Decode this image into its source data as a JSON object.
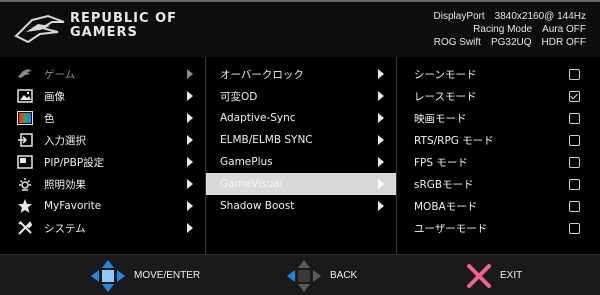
{
  "header": {
    "brand_line1": "REPUBLIC OF",
    "brand_line2": "GAMERS",
    "input": "DisplayPort",
    "resolution": "3840x2160@ 144Hz",
    "mode": "Racing Mode",
    "aura": "Aura OFF",
    "model": "ROG Swift",
    "model_number": "PG32UQ",
    "hdr": "HDR OFF"
  },
  "main_menu": [
    {
      "label": "ゲーム",
      "icon": "rog-eye-icon"
    },
    {
      "label": "画像",
      "icon": "image-icon"
    },
    {
      "label": "色",
      "icon": "color-icon"
    },
    {
      "label": "入力選択",
      "icon": "input-select-icon"
    },
    {
      "label": "PIP/PBP設定",
      "icon": "pip-pbp-icon"
    },
    {
      "label": "照明効果",
      "icon": "lighting-effect-icon"
    },
    {
      "label": "MyFavorite",
      "icon": "star-icon"
    },
    {
      "label": "システム",
      "icon": "tools-icon"
    }
  ],
  "sub_menu": [
    {
      "label": "オーバークロック"
    },
    {
      "label": "可変OD"
    },
    {
      "label": "Adaptive-Sync"
    },
    {
      "label": "ELMB/ELMB SYNC"
    },
    {
      "label": "GamePlus"
    },
    {
      "label": "GameVisual"
    },
    {
      "label": "Shadow Boost"
    }
  ],
  "options": [
    {
      "label": "シーンモード",
      "checked": false
    },
    {
      "label": "レースモード",
      "checked": true
    },
    {
      "label": "映画モード",
      "checked": false
    },
    {
      "label": "RTS/RPG モード",
      "checked": false
    },
    {
      "label": "FPS モード",
      "checked": false
    },
    {
      "label": "sRGBモード",
      "checked": false
    },
    {
      "label": "MOBAモード",
      "checked": false
    },
    {
      "label": "ユーザーモード",
      "checked": false
    }
  ],
  "footer": {
    "move_enter": "MOVE/ENTER",
    "back": "BACK",
    "exit": "EXIT"
  },
  "colors": {
    "selected_row": "#d9d9d9",
    "dpad_blue": "#1e88e5",
    "exit_pink": "#f06292"
  }
}
